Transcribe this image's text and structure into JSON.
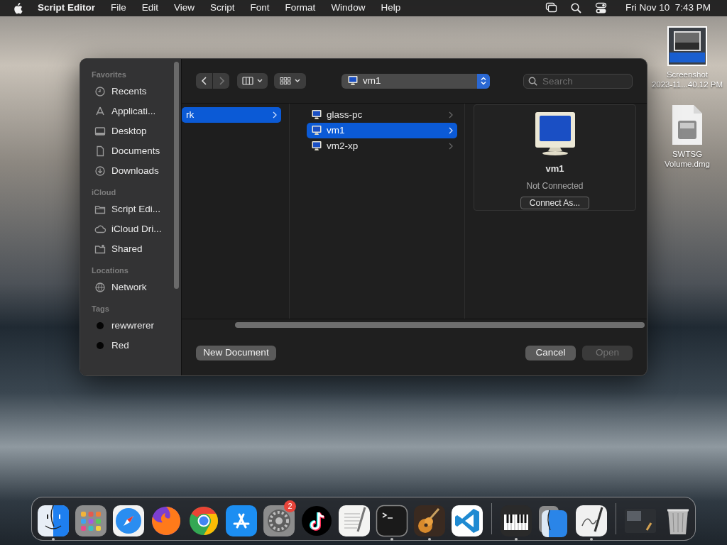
{
  "menu_bar": {
    "app_name": "Script Editor",
    "items": [
      "File",
      "Edit",
      "View",
      "Script",
      "Font",
      "Format",
      "Window",
      "Help"
    ],
    "clock": "Fri Nov 10  7:43 PM"
  },
  "desktop_icons": [
    {
      "kind": "screenshot",
      "label": "Screenshot\n2023-11...40.12 PM"
    },
    {
      "kind": "disk-image",
      "label": "SWTSG\nVolume.dmg"
    }
  ],
  "dialog": {
    "sidebar": {
      "sections": [
        {
          "title": "Favorites",
          "items": [
            {
              "kind": "clock",
              "label": "Recents"
            },
            {
              "kind": "apps",
              "label": "Applicati..."
            },
            {
              "kind": "desktop",
              "label": "Desktop"
            },
            {
              "kind": "document",
              "label": "Documents"
            },
            {
              "kind": "download",
              "label": "Downloads"
            }
          ]
        },
        {
          "title": "iCloud",
          "items": [
            {
              "kind": "folder",
              "label": "Script Edi..."
            },
            {
              "kind": "cloud",
              "label": "iCloud Dri..."
            },
            {
              "kind": "shared",
              "label": "Shared"
            }
          ]
        },
        {
          "title": "Locations",
          "items": [
            {
              "kind": "globe",
              "label": "Network"
            }
          ]
        },
        {
          "title": "Tags",
          "items": [
            {
              "kind": "tag",
              "label": "rewwrerer"
            },
            {
              "kind": "tag",
              "label": "Red"
            }
          ]
        }
      ]
    },
    "toolbar": {
      "path": "vm1",
      "search_placeholder": "Search"
    },
    "columns": [
      {
        "items": [
          {
            "kind": "plain",
            "label": "rk",
            "selected": true
          }
        ]
      },
      {
        "items": [
          {
            "kind": "monitor",
            "label": "glass-pc",
            "selected": false
          },
          {
            "kind": "monitor",
            "label": "vm1",
            "selected": true
          },
          {
            "kind": "monitor",
            "label": "vm2-xp",
            "selected": false
          }
        ]
      }
    ],
    "preview": {
      "name": "vm1",
      "status": "Not Connected",
      "button": "Connect As..."
    },
    "buttons": [
      {
        "label": "New Document",
        "kind": "left",
        "disabled": false
      },
      {
        "label": "Cancel",
        "kind": "right",
        "disabled": false
      },
      {
        "label": "Open",
        "kind": "right",
        "disabled": true
      }
    ]
  },
  "dock": [
    {
      "kind": "finder",
      "running": true
    },
    {
      "kind": "launchpad",
      "running": false
    },
    {
      "kind": "safari",
      "running": false
    },
    {
      "kind": "firefox",
      "running": false
    },
    {
      "kind": "chrome",
      "running": false
    },
    {
      "kind": "appstore",
      "running": false
    },
    {
      "kind": "settings",
      "running": false,
      "badge": "2"
    },
    {
      "kind": "tiktok",
      "running": false
    },
    {
      "kind": "textedit",
      "running": false
    },
    {
      "kind": "terminal",
      "running": true
    },
    {
      "kind": "garageband",
      "running": true
    },
    {
      "kind": "vscode",
      "running": false
    },
    {
      "kind": "separator"
    },
    {
      "kind": "piano",
      "running": true
    },
    {
      "kind": "migration",
      "running": false
    },
    {
      "kind": "scripteditor",
      "running": true
    },
    {
      "kind": "separator"
    },
    {
      "kind": "window",
      "running": false
    },
    {
      "kind": "trash",
      "running": false
    }
  ]
}
